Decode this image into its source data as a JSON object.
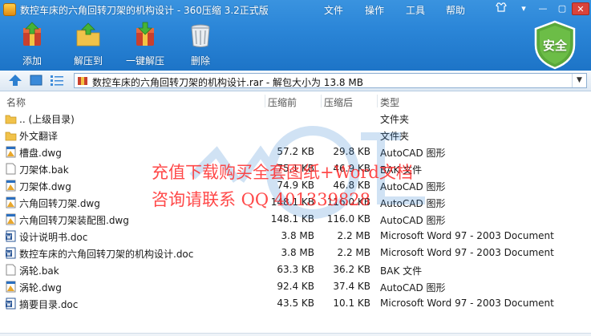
{
  "window": {
    "title": "数控车床的六角回转刀架的机构设计 - 360压缩 3.2正式版",
    "menus": [
      "文件",
      "操作",
      "工具",
      "帮助"
    ]
  },
  "toolbar": {
    "add_label": "添加",
    "extract_to_label": "解压到",
    "one_click_extract_label": "一键解压",
    "delete_label": "删除",
    "security_label": "安全"
  },
  "address": {
    "path": "数控车床的六角回转刀架的机构设计.rar - 解包大小为 13.8 MB"
  },
  "columns": {
    "name": "名称",
    "size": "压缩前",
    "compressed": "压缩后",
    "type": "类型"
  },
  "files": [
    {
      "icon": "folder-up-icon",
      "name": ".. (上级目录)",
      "size": "",
      "compressed": "",
      "type": "文件夹"
    },
    {
      "icon": "folder-icon",
      "name": "外文翻译",
      "size": "",
      "compressed": "",
      "type": "文件夹"
    },
    {
      "icon": "dwg-file-icon",
      "name": "槽盘.dwg",
      "size": "57.2 KB",
      "compressed": "29.8 KB",
      "type": "AutoCAD 图形"
    },
    {
      "icon": "bak-file-icon",
      "name": "刀架体.bak",
      "size": "75.1 KB",
      "compressed": "46.9 KB",
      "type": "BAK 文件"
    },
    {
      "icon": "dwg-file-icon",
      "name": "刀架体.dwg",
      "size": "74.9 KB",
      "compressed": "46.8 KB",
      "type": "AutoCAD 图形"
    },
    {
      "icon": "dwg-file-icon",
      "name": "六角回转刀架.dwg",
      "size": "148.1 KB",
      "compressed": "116.0 KB",
      "type": "AutoCAD 图形"
    },
    {
      "icon": "dwg-file-icon",
      "name": "六角回转刀架装配图.dwg",
      "size": "148.1 KB",
      "compressed": "116.0 KB",
      "type": "AutoCAD 图形"
    },
    {
      "icon": "doc-file-icon",
      "name": "设计说明书.doc",
      "size": "3.8 MB",
      "compressed": "2.2 MB",
      "type": "Microsoft Word 97 - 2003 Document"
    },
    {
      "icon": "doc-file-icon",
      "name": "数控车床的六角回转刀架的机构设计.doc",
      "size": "3.8 MB",
      "compressed": "2.2 MB",
      "type": "Microsoft Word 97 - 2003 Document"
    },
    {
      "icon": "bak-file-icon",
      "name": "涡轮.bak",
      "size": "63.3 KB",
      "compressed": "36.2 KB",
      "type": "BAK 文件"
    },
    {
      "icon": "dwg-file-icon",
      "name": "涡轮.dwg",
      "size": "92.4 KB",
      "compressed": "37.4 KB",
      "type": "AutoCAD 图形"
    },
    {
      "icon": "doc-file-icon",
      "name": "摘要目录.doc",
      "size": "43.5 KB",
      "compressed": "10.1 KB",
      "type": "Microsoft Word 97 - 2003 Document"
    }
  ],
  "watermark": {
    "line1": "充值下载购买全套图纸+Word文档",
    "line2": "咨询请联系 QQ 401339828"
  },
  "colors": {
    "toolbar_blue": "#2b86d8",
    "security_green": "#5aa83a",
    "watermark_red": "#ff2a2a",
    "folder_yellow": "#f1c24a"
  }
}
